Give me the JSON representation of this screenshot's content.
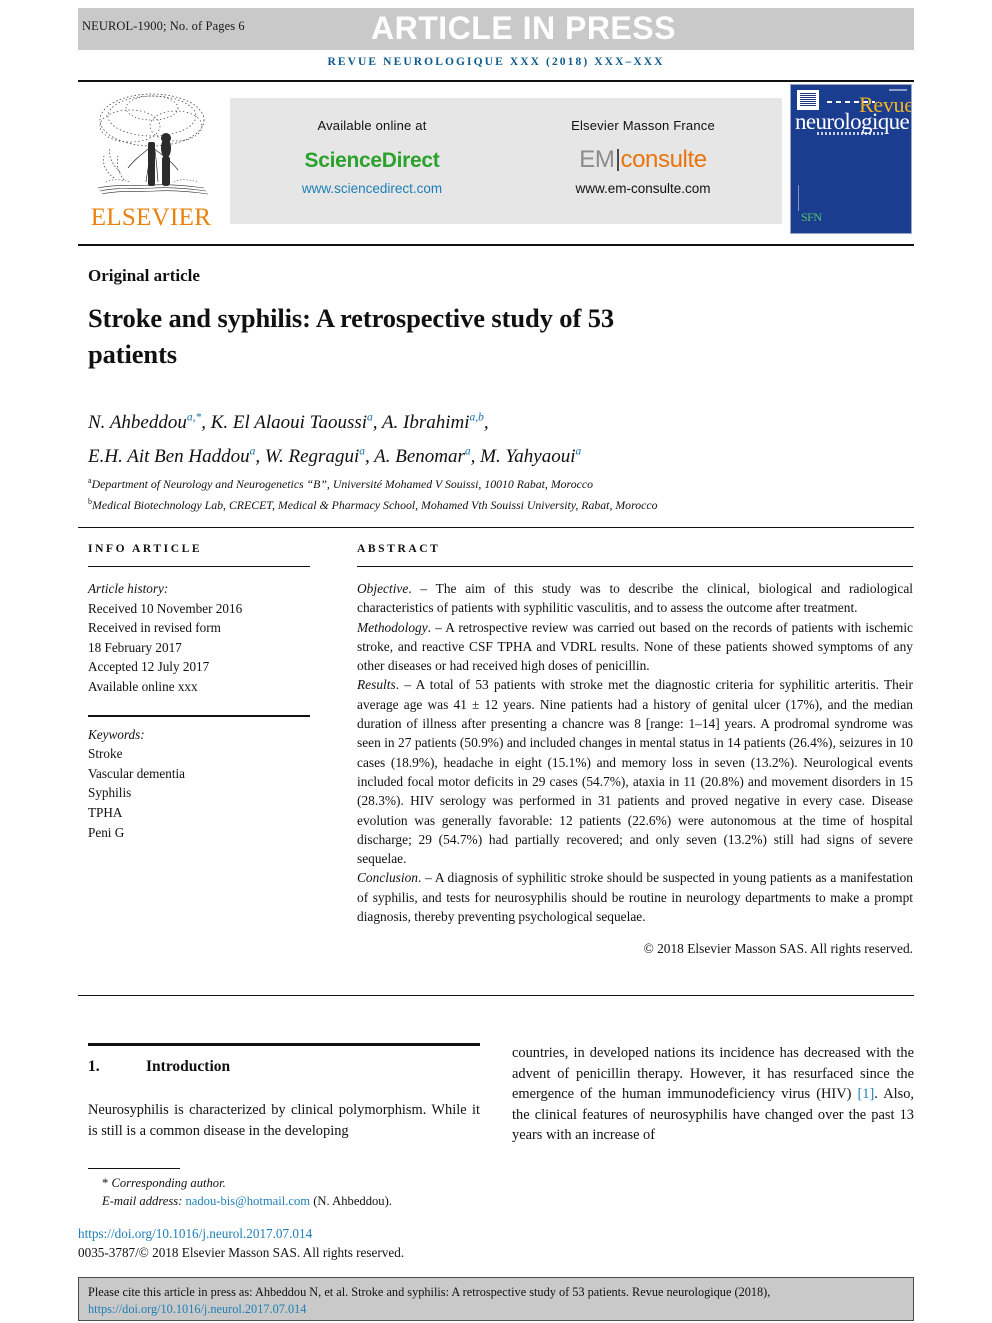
{
  "banner": {
    "journal_code": "NEUROL-1900; No. of Pages 6",
    "press_title": "ARTICLE IN PRESS",
    "journal_ref": "REVUE NEUROLOGIQUE XXX (2018) XXX–XXX"
  },
  "masthead": {
    "elsevier_word": "ELSEVIER",
    "available_online": "Available online at",
    "sciencedirect": "ScienceDirect",
    "sciencedirect_url": "www.sciencedirect.com",
    "elsevier_masson": "Elsevier Masson France",
    "em_part": "EM",
    "consulte_part": "consulte",
    "emconsulte_url": "www.em-consulte.com",
    "cover_revue": "Revue",
    "cover_neuro": "neurologique",
    "cover_mark": "SFN"
  },
  "article": {
    "kind": "Original article",
    "title": "Stroke and syphilis: A retrospective study of 53 patients",
    "authors_line1": "N. Ahbeddou",
    "authors_line1_sup1": "a,*",
    "authors_line1_b": ", K. El Alaoui Taoussi",
    "authors_line1_sup2": "a",
    "authors_line1_c": ", A. Ibrahimi",
    "authors_line1_sup3": "a,b",
    "authors_line1_d": ",",
    "authors_line2": "E.H. Ait Ben Haddou",
    "authors_line2_sup1": "a",
    "authors_line2_b": ", W. Regragui",
    "authors_line2_sup2": "a",
    "authors_line2_c": ", A. Benomar",
    "authors_line2_sup3": "a",
    "authors_line2_d": ", M. Yahyaoui",
    "authors_line2_sup4": "a",
    "affiliation_a_marker": "a",
    "affiliation_a": "Department of Neurology and Neurogenetics “B”, Université Mohamed V Souissi, 10010 Rabat, Morocco",
    "affiliation_b_marker": "b",
    "affiliation_b": "Medical Biotechnology Lab, CRECET, Medical & Pharmacy School, Mohamed Vth Souissi University, Rabat, Morocco"
  },
  "info": {
    "heading": "INFO ARTICLE",
    "history_label": "Article history:",
    "history": [
      "Received 10 November 2016",
      "Received in revised form",
      "18 February 2017",
      "Accepted 12 July 2017",
      "Available online xxx"
    ],
    "keywords_label": "Keywords:",
    "keywords": [
      "Stroke",
      "Vascular dementia",
      "Syphilis",
      "TPHA",
      "Peni G"
    ]
  },
  "abstract": {
    "heading": "ABSTRACT",
    "objective_label": "Objective",
    "objective_text": ". – The aim of this study was to describe the clinical, biological and radiological characteristics of patients with syphilitic vasculitis, and to assess the outcome after treatment.",
    "methodology_label": "Methodology",
    "methodology_text": ". – A retrospective review was carried out based on the records of patients with ischemic stroke, and reactive CSF TPHA and VDRL results. None of these patients showed symptoms of any other diseases or had received high doses of penicillin.",
    "results_label": "Results",
    "results_text": ". – A total of 53 patients with stroke met the diagnostic criteria for syphilitic arteritis. Their average age was 41 ± 12 years. Nine patients had a history of genital ulcer (17%), and the median duration of illness after presenting a chancre was 8 [range: 1–14] years. A prodromal syndrome was seen in 27 patients (50.9%) and included changes in mental status in 14 patients (26.4%), seizures in 10 cases (18.9%), headache in eight (15.1%) and memory loss in seven (13.2%). Neurological events included focal motor deficits in 29 cases (54.7%), ataxia in 11 (20.8%) and movement disorders in 15 (28.3%). HIV serology was performed in 31 patients and proved negative in every case. Disease evolution was generally favorable: 12 patients (22.6%) were autonomous at the time of hospital discharge; 29 (54.7%) had partially recovered; and only seven (13.2%) still had signs of severe sequelae.",
    "conclusion_label": "Conclusion",
    "conclusion_text": ". – A diagnosis of syphilitic stroke should be suspected in young patients as a manifestation of syphilis, and tests for neurosyphilis should be routine in neurology departments to make a prompt diagnosis, thereby preventing psychological sequelae.",
    "copyright": "© 2018 Elsevier Masson SAS. All rights reserved."
  },
  "body": {
    "section_number": "1.",
    "section_title": "Introduction",
    "left_paragraph": "Neurosyphilis is characterized by clinical polymorphism. While it is still is a common disease in the developing",
    "right_paragraph_a": "countries, in developed nations its incidence has decreased with the advent of penicillin therapy. However, it has resurfaced since the emergence of the human immunodeficiency virus (HIV) ",
    "right_ref": "[1]",
    "right_paragraph_b": ". Also, the clinical features of neurosyphilis have changed over the past 13 years with an increase of"
  },
  "footer": {
    "corresponding_marker": "*",
    "corresponding_author": "Corresponding author.",
    "email_label": "E-mail address:",
    "email": "nadou-bis@hotmail.com",
    "email_owner": "(N. Ahbeddou).",
    "doi": "https://doi.org/10.1016/j.neurol.2017.07.014",
    "issn": "0035-3787/© 2018 Elsevier Masson SAS. All rights reserved."
  },
  "cite_box": {
    "text": "Please cite this article in press as: Ahbeddou N, et al. Stroke and syphilis: A retrospective study of 53 patients. Revue neurologique (2018), ",
    "link": "https://doi.org/10.1016/j.neurol.2017.07.014"
  },
  "colors": {
    "banner_grey": "#c9c9c9",
    "journal_blue": "#0c5a8c",
    "link_blue": "#1d7fb5",
    "sciencedirect_green": "#2ba22b",
    "elsevier_orange": "#e8820c",
    "cover_blue": "#1b3d8f",
    "cover_gold": "#f0b323"
  }
}
